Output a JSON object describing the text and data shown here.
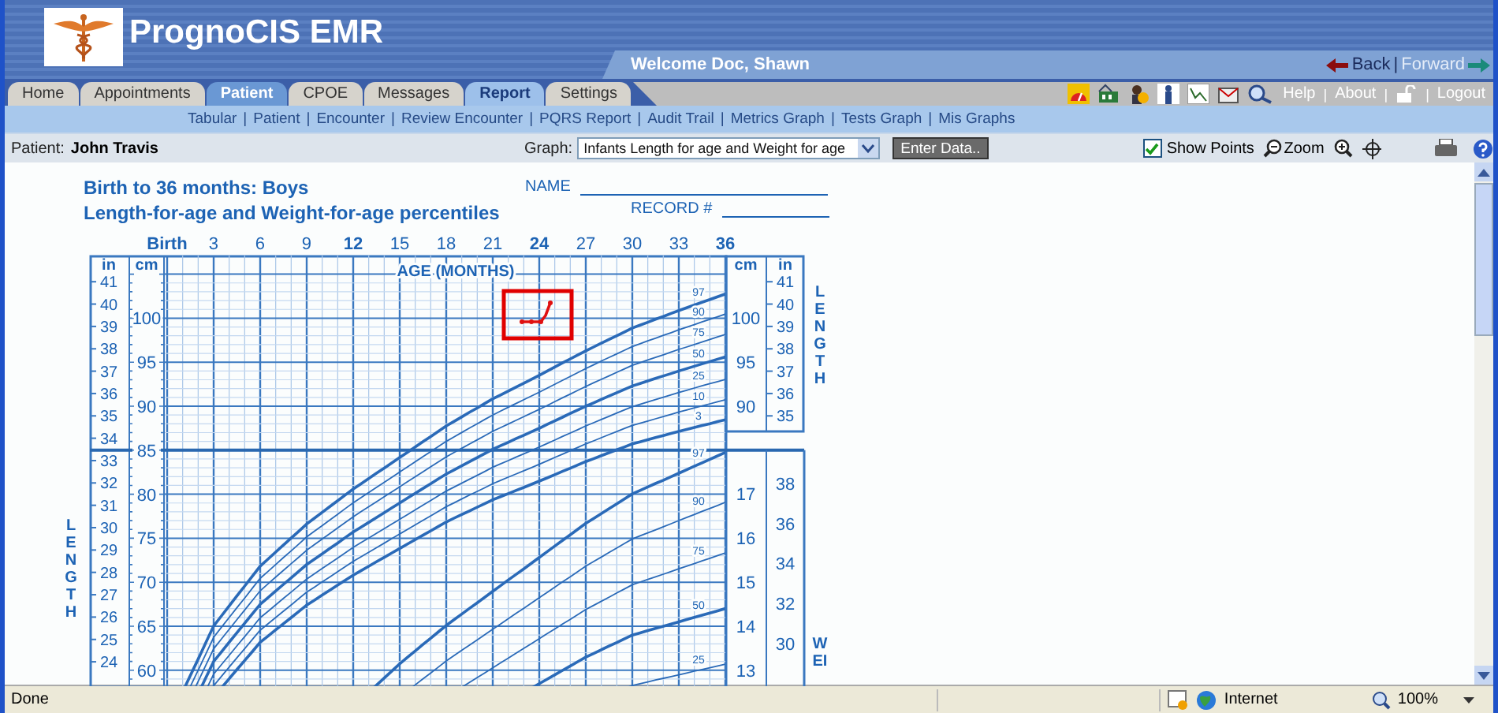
{
  "app": {
    "title": "PrognoCIS EMR",
    "welcome": "Welcome Doc, Shawn",
    "back": "Back",
    "separator": "|",
    "forward": "Forward"
  },
  "tabs": [
    {
      "label": "Home",
      "selected": false,
      "highlighted": false
    },
    {
      "label": "Appointments",
      "selected": false,
      "highlighted": false
    },
    {
      "label": "Patient",
      "selected": true,
      "highlighted": false
    },
    {
      "label": "CPOE",
      "selected": false,
      "highlighted": false
    },
    {
      "label": "Messages",
      "selected": false,
      "highlighted": false
    },
    {
      "label": "Report",
      "selected": false,
      "highlighted": true
    },
    {
      "label": "Settings",
      "selected": false,
      "highlighted": false
    }
  ],
  "top_links": [
    "Help",
    "About",
    "Logout"
  ],
  "subnav": [
    "Tabular",
    "Patient",
    "Encounter",
    "Review Encounter",
    "PQRS Report",
    "Audit Trail",
    "Metrics Graph",
    "Tests Graph",
    "Mis Graphs"
  ],
  "toolbar": {
    "patient_label": "Patient:",
    "patient_name": "John Travis",
    "graph_label": "Graph:",
    "graph_value": "Infants Length for age and Weight for age",
    "enter_button": "Enter Data..",
    "show_points": {
      "label": "Show Points",
      "checked": true
    },
    "zoom_label": "Zoom"
  },
  "chart": {
    "title_lines": [
      "Birth to 36 months: Boys",
      "Length-for-age and Weight-for-age percentiles"
    ],
    "name_label": "NAME",
    "record_label": "RECORD #",
    "age_ticks": [
      "Birth",
      "3",
      "6",
      "9",
      "12",
      "15",
      "18",
      "21",
      "24",
      "27",
      "30",
      "33",
      "36"
    ],
    "age_label": "AGE (MONTHS)",
    "unit_in_left": "in",
    "unit_cm_left": "cm",
    "unit_cm_right": "cm",
    "unit_in_right": "in",
    "left_in_ticks": [
      "41",
      "40",
      "39",
      "38",
      "37",
      "36",
      "35",
      "34",
      "33",
      "32",
      "31",
      "30",
      "29",
      "28",
      "27",
      "26",
      "25",
      "24"
    ],
    "left_cm_ticks": [
      "100",
      "95",
      "90",
      "85",
      "80",
      "75",
      "70",
      "65",
      "60"
    ],
    "right_cm_ticks": [
      "100",
      "95",
      "90"
    ],
    "right_in_ticks": [
      "41",
      "40",
      "39",
      "38",
      "37",
      "36",
      "35"
    ],
    "right_kg_ticks": [
      "17",
      "16",
      "15",
      "14",
      "13"
    ],
    "right_lb_ticks": [
      "38",
      "36",
      "34",
      "32",
      "30"
    ],
    "length_percentiles": [
      "97",
      "90",
      "75",
      "50",
      "25",
      "10",
      "3"
    ],
    "weight_percentiles": [
      "97",
      "90",
      "75",
      "50",
      "25"
    ],
    "length_axis_label_left": "LENGTH",
    "length_axis_label_right": "LENGTH",
    "weight_axis_label": "WEI"
  },
  "status_bar": {
    "status": "Done",
    "zone": "Internet",
    "zoom": "100%"
  }
}
